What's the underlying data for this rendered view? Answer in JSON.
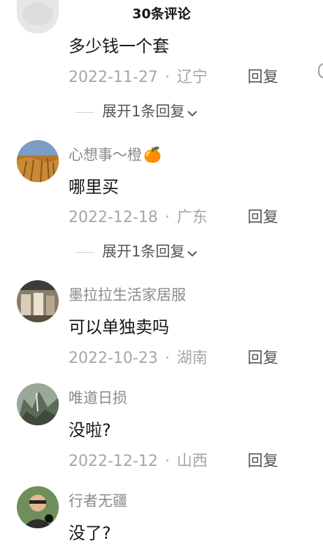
{
  "header": {
    "title": "30条评论"
  },
  "comments": [
    {
      "username": "",
      "text": "多少钱一个套",
      "date": "2022-11-27",
      "dot": "·",
      "location": "辽宁",
      "reply_label": "回复",
      "expand_label": "展开1条回复"
    },
    {
      "username": "心想事～橙",
      "emoji": "🍊",
      "text": "哪里买",
      "date": "2022-12-18",
      "dot": "·",
      "location": "广东",
      "reply_label": "回复",
      "expand_label": "展开1条回复"
    },
    {
      "username": "墨拉拉生活家居服",
      "text": "可以单独卖吗",
      "date": "2022-10-23",
      "dot": "·",
      "location": "湖南",
      "reply_label": "回复"
    },
    {
      "username": "唯道日损",
      "text": "没啦?",
      "date": "2022-12-12",
      "dot": "·",
      "location": "山西",
      "reply_label": "回复"
    },
    {
      "username": "行者无疆",
      "text": "没了?"
    }
  ]
}
